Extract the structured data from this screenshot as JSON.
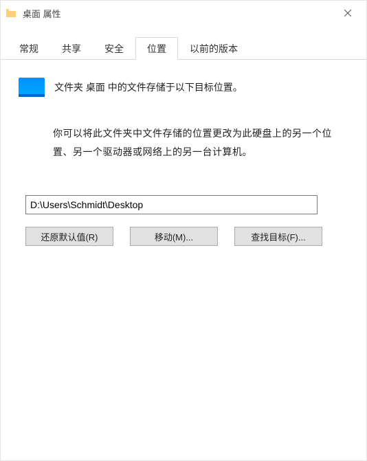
{
  "window": {
    "title": "桌面 属性"
  },
  "tabs": {
    "general": "常规",
    "sharing": "共享",
    "security": "安全",
    "location": "位置",
    "previous": "以前的版本"
  },
  "content": {
    "desc": "文件夹 桌面 中的文件存储于以下目标位置。",
    "long": "你可以将此文件夹中文件存储的位置更改为此硬盘上的另一个位置、另一个驱动器或网络上的另一台计算机。",
    "path": "D:\\Users\\Schmidt\\Desktop"
  },
  "buttons": {
    "restore": "还原默认值(R)",
    "move": "移动(M)...",
    "find": "查找目标(F)..."
  }
}
